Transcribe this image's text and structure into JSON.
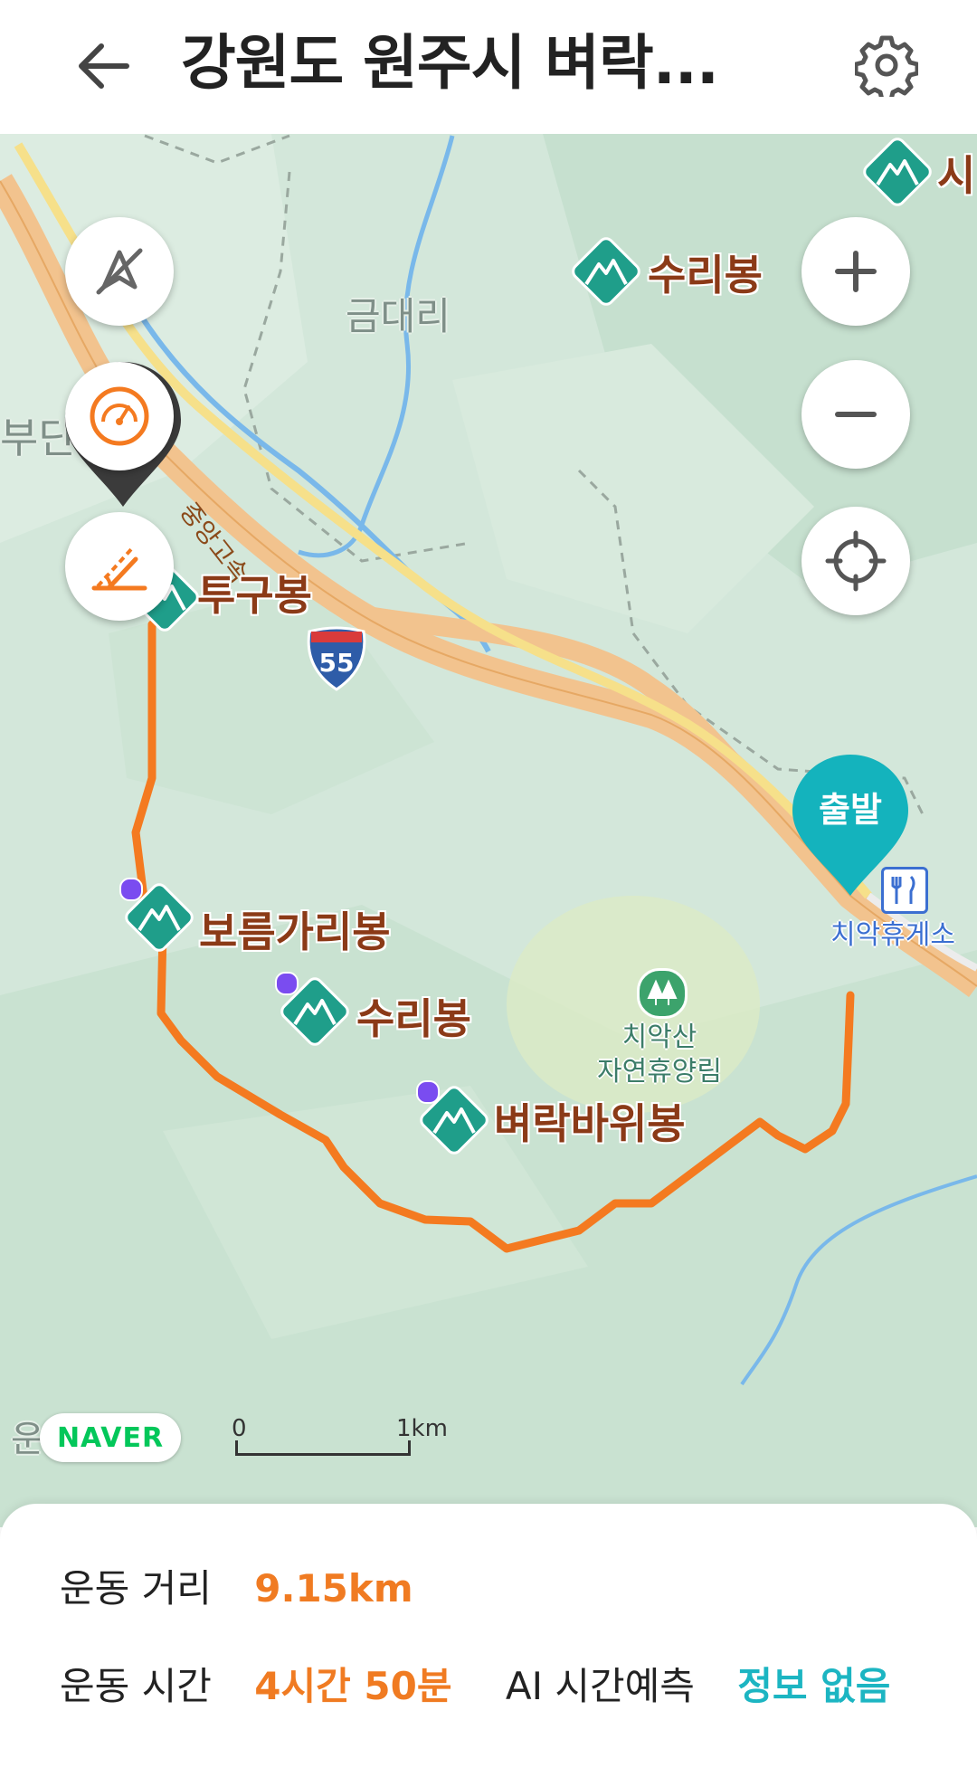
{
  "header": {
    "title": "강원도 원주시 벼락...",
    "back_icon": "arrow-left-icon",
    "settings_icon": "gear-icon"
  },
  "map": {
    "area_labels": [
      "금대리",
      "부단",
      "운학리"
    ],
    "road_label": "중앙고속",
    "highway_shield": "55",
    "peaks": [
      "시",
      "수리봉",
      "투구봉",
      "보름가리봉",
      "수리봉",
      "벼락바위봉"
    ],
    "poi": {
      "forest": "치악산\n자연휴양림",
      "rest_area": "치악휴게소"
    },
    "start_marker": "출발",
    "attribution": "NAVER",
    "scale": {
      "start": "0",
      "end": "1km"
    },
    "controls": {
      "compass_icon": "compass-off-icon",
      "speed_icon": "gauge-icon",
      "slope_icon": "slope-icon",
      "zoom_in_icon": "plus-icon",
      "zoom_out_icon": "minus-icon",
      "locate_icon": "crosshair-icon"
    },
    "colors": {
      "route": "#f47a20",
      "peak_marker": "#1f9e8a",
      "start_marker": "#14b3bd"
    }
  },
  "summary": {
    "distance_label": "운동 거리",
    "distance_value": "9.15km",
    "time_label": "운동 시간",
    "time_value": "4시간 50분",
    "ai_label": "AI 시간예측",
    "ai_value": "정보 없음"
  }
}
